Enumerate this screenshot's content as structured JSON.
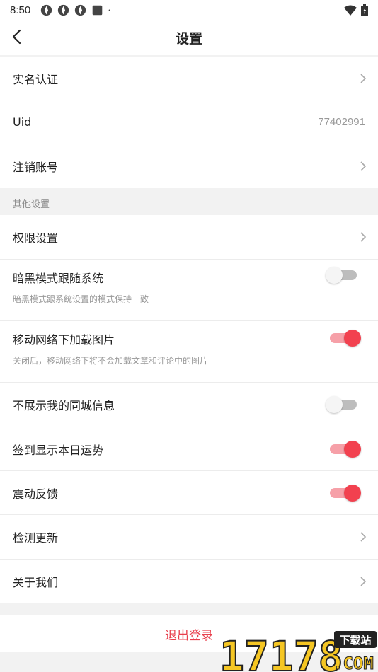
{
  "status_bar": {
    "time": "8:50",
    "icons": [
      "app-icon",
      "app-icon",
      "app-icon",
      "square-icon",
      "dot-icon"
    ],
    "right_icons": [
      "wifi-icon",
      "battery-icon"
    ]
  },
  "nav": {
    "title": "设置",
    "back_icon": "back-arrow-icon"
  },
  "account": {
    "realname_label": "实名认证",
    "uid_label": "Uid",
    "uid_value": "77402991",
    "cancel_account_label": "注销账号"
  },
  "other_settings": {
    "section_title": "其他设置",
    "permissions_label": "权限设置",
    "dark_mode_label": "暗黑模式跟随系统",
    "dark_mode_desc": "暗黑模式跟系统设置的模式保持一致",
    "dark_mode_on": false,
    "mobile_images_label": "移动网络下加载图片",
    "mobile_images_desc": "关闭后，移动网络下将不会加载文章和评论中的图片",
    "mobile_images_on": true,
    "hide_city_label": "不展示我的同城信息",
    "hide_city_on": false,
    "fortune_label": "签到显示本日运势",
    "fortune_on": true,
    "vibration_label": "震动反馈",
    "vibration_on": true,
    "check_update_label": "检测更新",
    "about_label": "关于我们"
  },
  "logout_label": "退出登录",
  "colors": {
    "accent": "#f2414f",
    "toggle_on_track": "#f6a0a8",
    "toggle_off_track": "#bdbdbd",
    "logout_text": "#e8404d"
  },
  "watermark": {
    "digits": "17178",
    "badge": "下载站",
    "domain": ".COM"
  }
}
